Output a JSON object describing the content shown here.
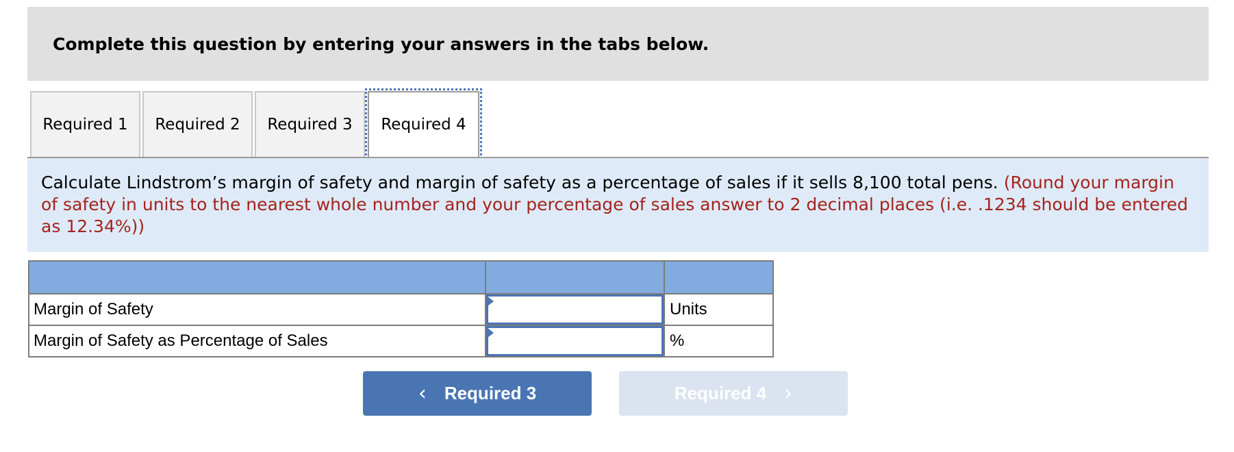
{
  "header": {
    "title": "Complete this question by entering your answers in the tabs below."
  },
  "tabs": [
    {
      "label": "Required 1",
      "active": false
    },
    {
      "label": "Required 2",
      "active": false
    },
    {
      "label": "Required 3",
      "active": false
    },
    {
      "label": "Required 4",
      "active": true
    }
  ],
  "instructions": {
    "text": "Calculate Lindstrom’s margin of safety and margin of safety as a percentage of sales if it sells 8,100 total pens.",
    "note": "(Round your margin of safety in units to the nearest whole number and your percentage of sales answer to 2 decimal places (i.e. .1234 should be entered as 12.34%))"
  },
  "table": {
    "header": [
      "",
      "",
      ""
    ],
    "rows": [
      {
        "label": "Margin of Safety",
        "value": "",
        "unit": "Units"
      },
      {
        "label": "Margin of Safety as Percentage of Sales",
        "value": "",
        "unit": "%"
      }
    ]
  },
  "navigation": {
    "prev": {
      "label": "Required 3",
      "icon": "chevron-left-icon",
      "glyph": "‹",
      "enabled": true
    },
    "next": {
      "label": "Required 4",
      "icon": "chevron-right-icon",
      "glyph": "›",
      "enabled": false
    }
  },
  "colors": {
    "header_bg": "#e0e0e0",
    "instructions_bg": "#deeaf7",
    "note_text": "#a5231d",
    "table_header_bg": "#82abdf",
    "accent": "#4a75b3",
    "disabled_button_bg": "#dae3ef"
  }
}
